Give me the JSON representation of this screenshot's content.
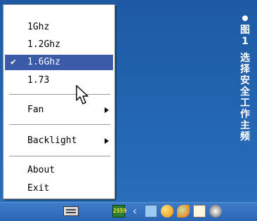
{
  "menu": {
    "items": [
      {
        "label": "1Ghz",
        "checked": false
      },
      {
        "label": "1.2Ghz",
        "checked": false
      },
      {
        "label": "1.6Ghz",
        "checked": true
      },
      {
        "label": "1.73",
        "checked": false
      },
      {
        "label": "Fan",
        "submenu": true
      },
      {
        "label": "Backlight",
        "submenu": true
      },
      {
        "label": "About"
      },
      {
        "label": "Exit"
      }
    ],
    "check_glyph": "✔"
  },
  "caption": {
    "fig_char": "图",
    "fig_num": "1",
    "text_chars": [
      "选",
      "择",
      "安",
      "全",
      "工",
      "作",
      "主",
      "频"
    ]
  },
  "taskbar": {
    "tray_speed_label": "2559"
  },
  "colors": {
    "selection": "#3b5aa8",
    "desktop": "#1e5fa8"
  }
}
